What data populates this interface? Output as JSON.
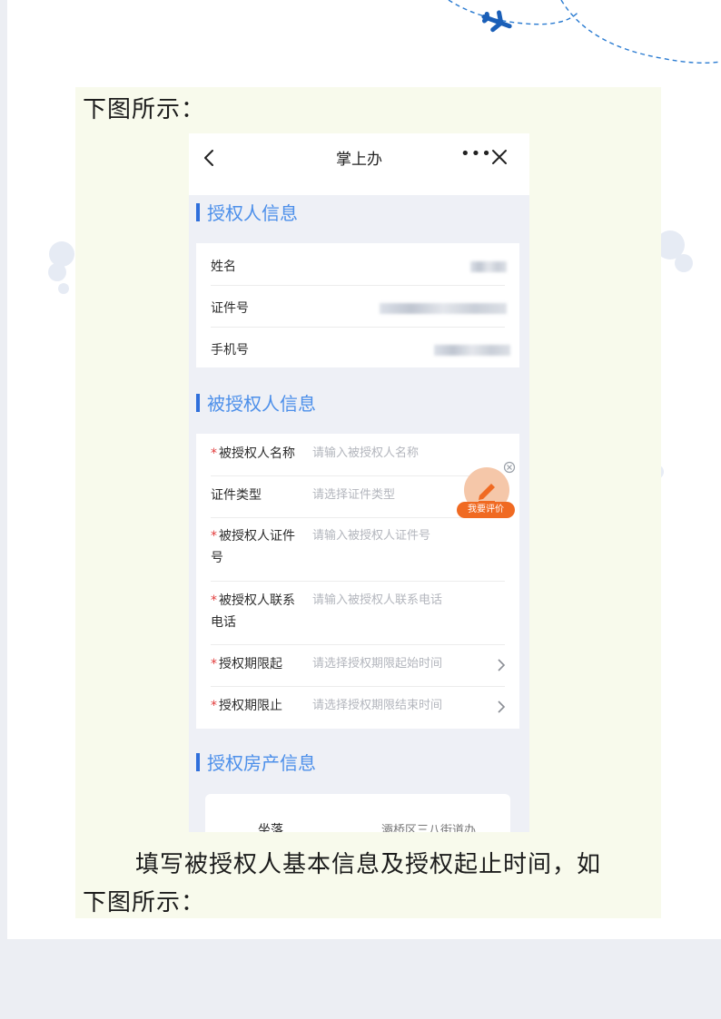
{
  "doc": {
    "caption_top": "下图所示：",
    "paragraph_line1": "填写被授权人基本信息及授权起止时间，如",
    "paragraph_line2": "下图所示："
  },
  "screenshot": {
    "header": {
      "title": "掌上办",
      "more_icon": "more-icon",
      "more_glyph": "•••",
      "back_icon": "chevron-left-icon",
      "close_icon": "close-icon"
    },
    "grantor_section": {
      "title": "授权人信息",
      "rows": [
        {
          "label": "姓名"
        },
        {
          "label": "证件号"
        },
        {
          "label": "手机号"
        }
      ]
    },
    "grantee_section": {
      "title": "被授权人信息",
      "fields": [
        {
          "label": "被授权人名称",
          "placeholder": "请输入被授权人名称",
          "required": true
        },
        {
          "label": "证件类型",
          "placeholder": "请选择证件类型",
          "required": false
        },
        {
          "label": "被授权人证件号",
          "placeholder": "请输入被授权人证件号",
          "required": true
        },
        {
          "label": "被授权人联系电话",
          "placeholder": "请输入被授权人联系电话",
          "required": true
        },
        {
          "label": "授权期限起",
          "placeholder": "请选择授权期限起始时间",
          "required": true
        },
        {
          "label": "授权期限止",
          "placeholder": "请选择授权期限结束时间",
          "required": true
        }
      ],
      "required_mark": "*"
    },
    "evaluate_button": {
      "label": "我要评价",
      "icon": "pencil-icon"
    },
    "property_section": {
      "title": "授权房产信息",
      "address_label": "坐落",
      "address_value": "灞桥区三八街道办"
    }
  },
  "colors": {
    "accent_blue": "#2f6fdb",
    "section_text": "#4c8fea",
    "required_red": "#e23b3b",
    "evaluate_orange": "#f06a22",
    "doc_block_bg": "#f8faec"
  }
}
